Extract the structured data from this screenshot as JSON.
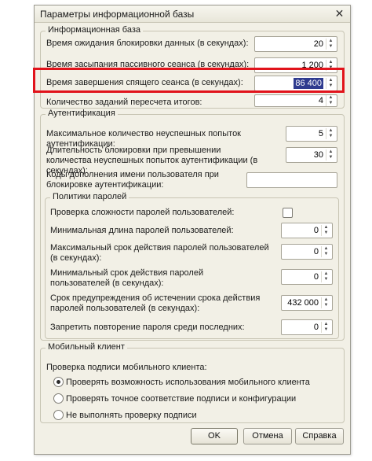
{
  "window": {
    "title": "Параметры информационной базы"
  },
  "infobase": {
    "title": "Информационная база",
    "rows": [
      {
        "label": "Время ожидания блокировки данных (в секундах):",
        "value": "20"
      },
      {
        "label": "Время засыпания пассивного сеанса (в секундах):",
        "value": "1 200"
      },
      {
        "label": "Время завершения спящего сеанса (в секундах):",
        "value": "86 400"
      },
      {
        "label": "Количество заданий пересчета итогов:",
        "value": "4"
      }
    ]
  },
  "auth": {
    "title": "Аутентификация",
    "max_attempts_label": "Максимальное количество неуспешных попыток аутентификации:",
    "max_attempts_value": "5",
    "block_label": "Длительность блокировки при превышении количества неуспешных попыток аутентификации (в секундах):",
    "block_value": "30",
    "codes_label": "Коды дополнения имени пользователя при блокировке аутентификации:",
    "codes_value": ""
  },
  "password": {
    "title": "Политики паролей",
    "complexity_label": "Проверка сложности паролей пользователей:",
    "complexity_checked": false,
    "rows": [
      {
        "label": "Минимальная длина паролей пользователей:",
        "value": "0"
      },
      {
        "label": "Максимальный срок действия паролей пользователей (в секундах):",
        "value": "0"
      },
      {
        "label": "Минимальный срок действия паролей пользователей (в секундах):",
        "value": "0"
      },
      {
        "label": "Срок предупреждения об истечении срока действия паролей пользователей (в секундах):",
        "value": "432 000"
      },
      {
        "label": "Запретить повторение пароля среди последних:",
        "value": "0"
      }
    ]
  },
  "mobile": {
    "title": "Мобильный клиент",
    "signature_label": "Проверка подписи мобильного клиента:",
    "options": [
      {
        "label": "Проверять возможность использования мобильного клиента",
        "selected": true
      },
      {
        "label": "Проверять точное соответствие подписи и конфигурации",
        "selected": false
      },
      {
        "label": "Не выполнять проверку подписи",
        "selected": false
      }
    ]
  },
  "buttons": {
    "ok": "OK",
    "cancel": "Отмена",
    "help": "Справка"
  },
  "colors": {
    "highlight": "#e1131b",
    "selection": "#2f3b8f"
  },
  "icons": {
    "close": "close-icon",
    "spin": "spin-arrows-icon"
  }
}
